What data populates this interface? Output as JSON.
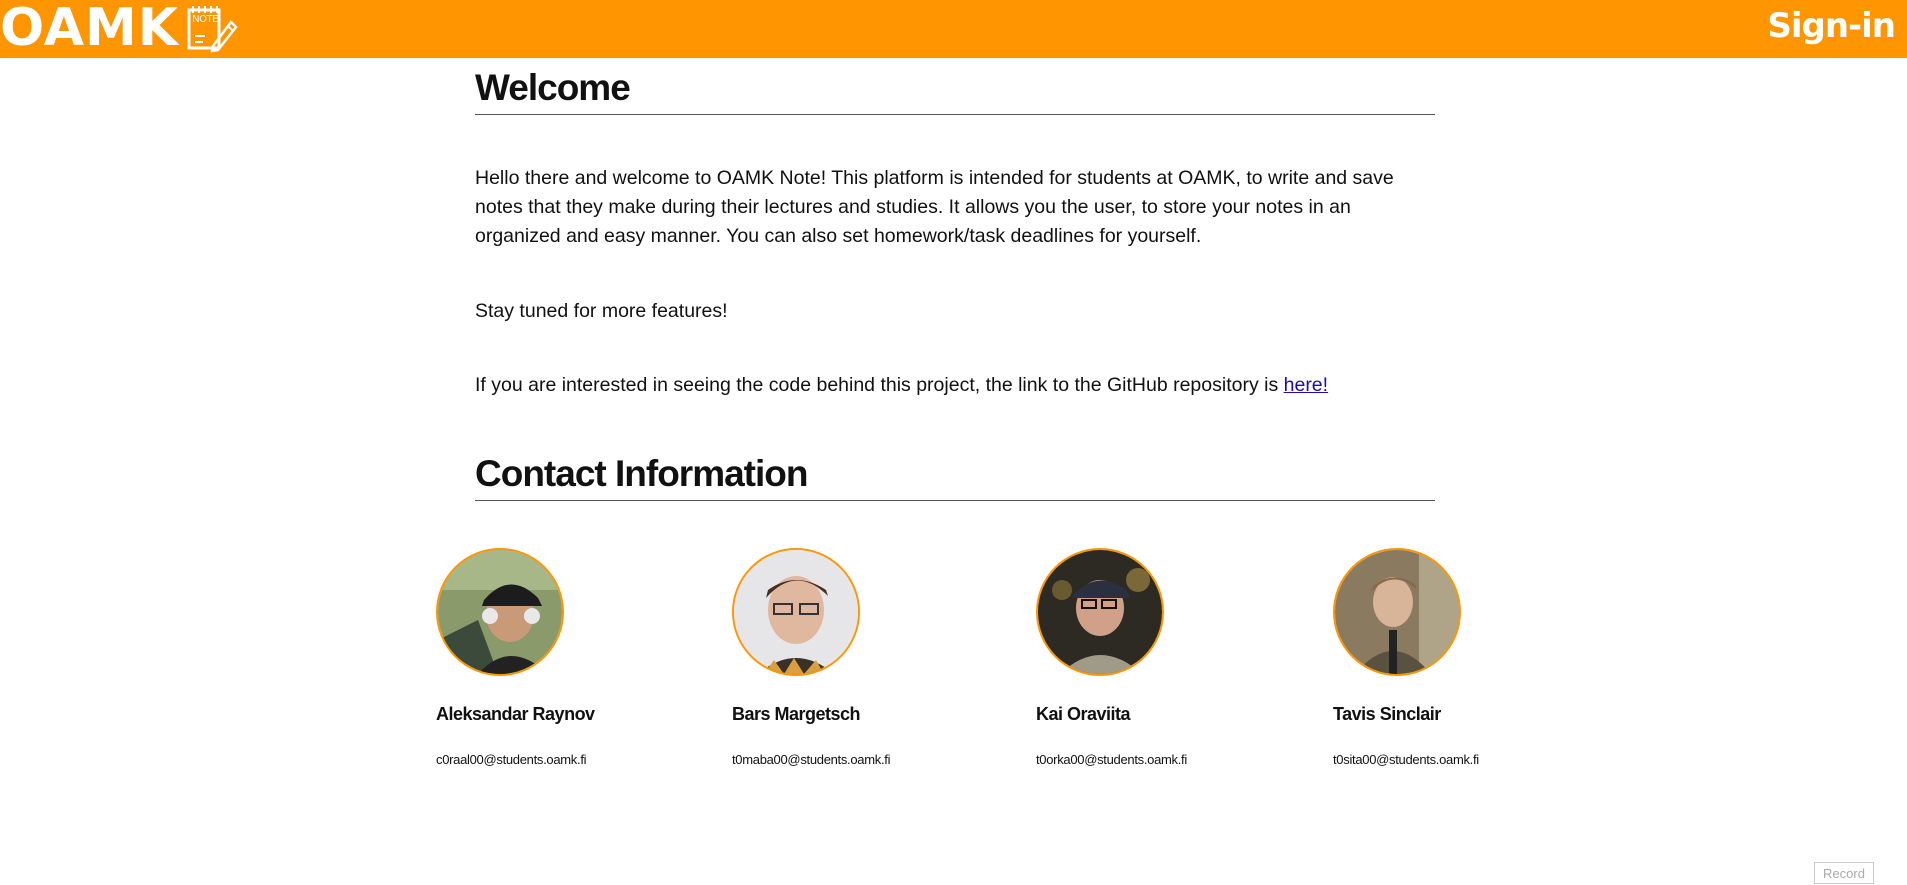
{
  "header": {
    "logo_text": "OAMK",
    "logo_badge": "NOTE",
    "signin_label": "Sign-in"
  },
  "welcome": {
    "title": "Welcome",
    "paragraph1": "Hello there and welcome to OAMK Note! This platform is intended for students at OAMK, to write and save notes that they make during their lectures and studies. It allows you the user, to store your notes in an organized and easy manner. You can also set homework/task deadlines for yourself.",
    "paragraph2": "Stay tuned for more features!",
    "paragraph3_prefix": "If you are interested in seeing the code behind this project, the link to the GitHub repository is ",
    "paragraph3_link": "here!"
  },
  "contact": {
    "title": "Contact Information",
    "people": [
      {
        "name": "Aleksandar Raynov",
        "email": "c0raal00@students.oamk.fi"
      },
      {
        "name": "Bars Margetsch",
        "email": "t0maba00@students.oamk.fi"
      },
      {
        "name": "Kai Oraviita",
        "email": "t0orka00@students.oamk.fi"
      },
      {
        "name": "Tavis Sinclair",
        "email": "t0sita00@students.oamk.fi"
      }
    ]
  },
  "footer": {
    "record_label": "Record"
  },
  "colors": {
    "accent": "#FF9500",
    "link": "#1a0dab",
    "text": "#111111"
  }
}
